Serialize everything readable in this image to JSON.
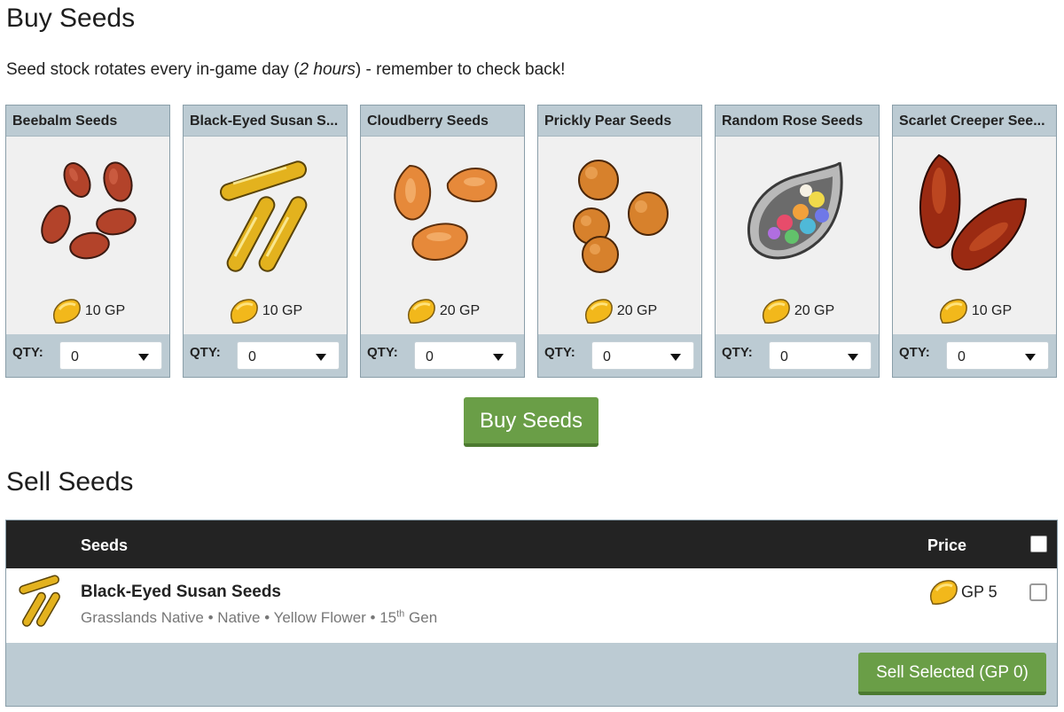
{
  "buy_section": {
    "title": "Buy Seeds",
    "intro_before": "Seed stock rotates every in-game day (",
    "intro_italic": "2 hours",
    "intro_after": ") - remember to check back!",
    "qty_label": "QTY:",
    "items": [
      {
        "name": "Beebalm Seeds",
        "price": "10 GP",
        "qty": "0",
        "icon": "beebalm-seeds-icon"
      },
      {
        "name": "Black-Eyed Susan S...",
        "price": "10 GP",
        "qty": "0",
        "icon": "black-eyed-susan-seeds-icon"
      },
      {
        "name": "Cloudberry Seeds",
        "price": "20 GP",
        "qty": "0",
        "icon": "cloudberry-seeds-icon"
      },
      {
        "name": "Prickly Pear Seeds",
        "price": "20 GP",
        "qty": "0",
        "icon": "prickly-pear-seeds-icon"
      },
      {
        "name": "Random Rose Seeds",
        "price": "20 GP",
        "qty": "0",
        "icon": "random-rose-seeds-icon"
      },
      {
        "name": "Scarlet Creeper See...",
        "price": "10 GP",
        "qty": "0",
        "icon": "scarlet-creeper-seeds-icon"
      }
    ],
    "buy_button": "Buy Seeds"
  },
  "sell_section": {
    "title": "Sell Seeds",
    "header": {
      "seeds": "Seeds",
      "price": "Price"
    },
    "rows": [
      {
        "name": "Black-Eyed Susan Seeds",
        "meta": "Grasslands Native • Native • Yellow Flower • 15",
        "meta_sup": "th",
        "meta_end": " Gen",
        "price": "GP 5",
        "checked": false
      }
    ],
    "sell_button": "Sell Selected (GP 0)"
  },
  "colors": {
    "card_header": "#bccbd3",
    "table_header": "#232323",
    "button_green": "#6a9e47"
  }
}
